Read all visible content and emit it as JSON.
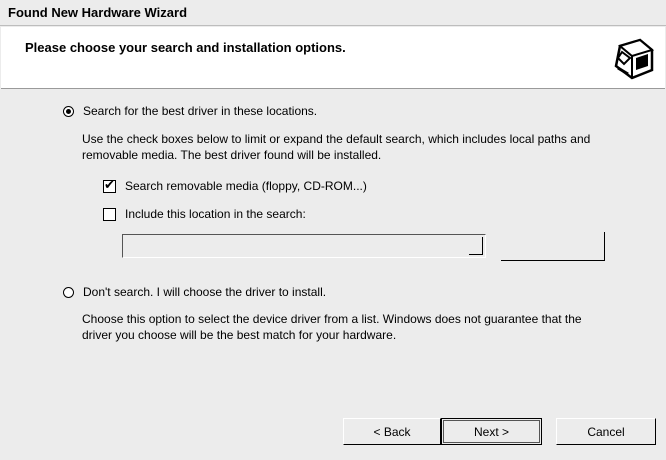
{
  "window": {
    "title": "Found New Hardware Wizard"
  },
  "header": {
    "heading": "Please choose your search and installation options.",
    "icon": "hardware-wizard-icon"
  },
  "options": {
    "search": {
      "label": "Search for the best driver in these locations.",
      "selected": true,
      "description_line1": "Use the check boxes below to limit or expand the default search, which includes local paths and",
      "description_line2": "removable media. The best driver found will be installed.",
      "removable_media": {
        "label": "Search removable media (floppy, CD-ROM...)",
        "checked": true,
        "check_glyph": "✔"
      },
      "include_location": {
        "label": "Include this location in the search:",
        "checked": false
      },
      "path_value": "",
      "browse_label": ""
    },
    "dont_search": {
      "label": "Don't search. I will choose the driver to install.",
      "selected": false,
      "description_line1": "Choose this option to select the device driver from a list.  Windows does not guarantee that the",
      "description_line2": "driver you choose will be the best match for your hardware."
    }
  },
  "buttons": {
    "back": "< Back",
    "next": "Next >",
    "cancel": "Cancel"
  }
}
